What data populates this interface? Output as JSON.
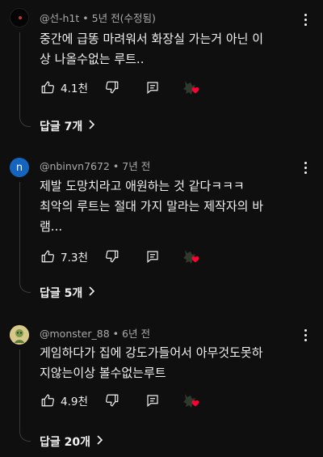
{
  "comments": [
    {
      "author": "@선-h1t",
      "time": "5년 전(수정됨)",
      "lines": [
        "중간에 급똥 마려워서 화장실 가는거 아닌 이",
        "상 나올수없는 루트.."
      ],
      "likes": "4.1천",
      "replies_label": "답글 7개",
      "avatar_color": "#000000",
      "avatar_letter": ""
    },
    {
      "author": "@nbinvn7672",
      "time": "7년 전",
      "lines": [
        "제발 도망치라고 애원하는 것 같다ㅋㅋㅋ",
        "최악의 루트는 절대 가지 말라는  제작자의 바",
        "램..."
      ],
      "likes": "7.3천",
      "replies_label": "답글 5개",
      "avatar_color": "#1565c0",
      "avatar_letter": "n"
    },
    {
      "author": "@monster_88",
      "time": "6년 전",
      "lines": [
        "게임하다가 집에 강도가들어서 아무것도못하",
        "지않는이상 볼수없는루트"
      ],
      "likes": "4.9천",
      "replies_label": "답글 20개",
      "avatar_color": "#d8c98a",
      "avatar_letter": ""
    }
  ],
  "meta_separator": "•",
  "colors": {
    "background": "#0f0f0f",
    "text": "#f1f1f1",
    "secondary": "#aaaaaa",
    "heart": "#ff0033"
  },
  "icons": [
    "more-vert-icon",
    "thumb-up-icon",
    "thumb-down-icon",
    "reply-icon",
    "creator-heart-icon",
    "chevron-right-icon"
  ]
}
